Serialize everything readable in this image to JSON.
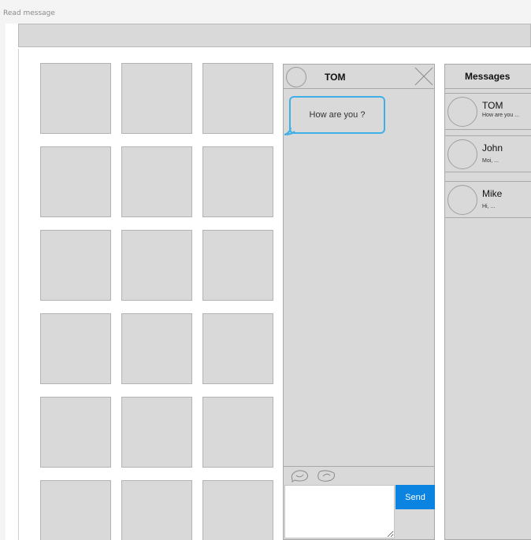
{
  "window": {
    "title": "Read message"
  },
  "grid": {
    "tile_count": 18
  },
  "chat": {
    "contact_name": "TOM",
    "messages": [
      {
        "text": "How are you ?"
      }
    ],
    "emoji_icons": [
      "smiley-icon",
      "sticker-icon"
    ],
    "reply_value": "",
    "send_label": "Send",
    "accent_color": "#3fb0e6",
    "send_color": "#0a84e0"
  },
  "messages_panel": {
    "title": "Messages",
    "conversations": [
      {
        "name": "TOM",
        "preview": "How are you ..."
      },
      {
        "name": "John",
        "preview": "Moi, ..."
      },
      {
        "name": "Mike",
        "preview": "Hi, ..."
      }
    ]
  }
}
